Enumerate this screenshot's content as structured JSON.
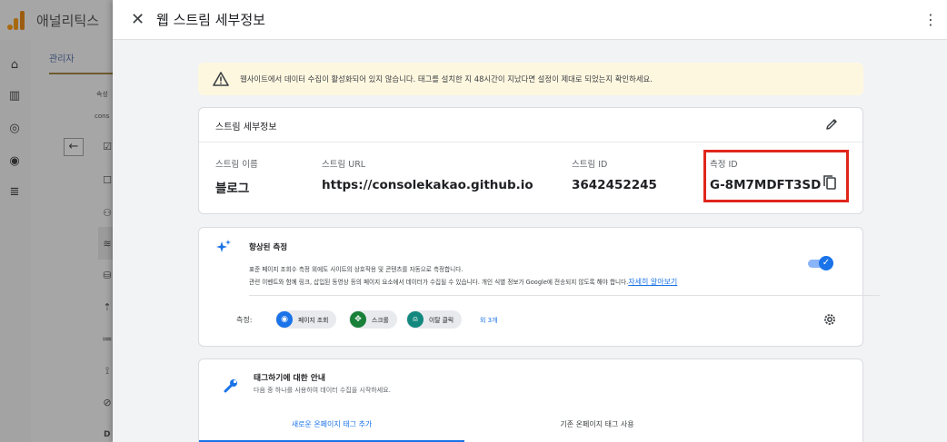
{
  "background": {
    "app_title": "애널리틱스",
    "admin_tab": "관리자",
    "small_label_1": "속성",
    "small_label_2": "cons",
    "bottom_letter": "D"
  },
  "drawer": {
    "title": "웹 스트림 세부정보",
    "warning": "웹사이트에서 데이터 수집이 활성화되어 있지 않습니다. 태그를 설치한 지 48시간이 지났다면 설정이 제대로 되었는지 확인하세요.",
    "stream_details": {
      "heading": "스트림 세부정보",
      "fields": {
        "name": {
          "label": "스트림 이름",
          "value": "블로그"
        },
        "url": {
          "label": "스트림 URL",
          "value": "https://consolekakao.github.io"
        },
        "stream_id": {
          "label": "스트림 ID",
          "value": "3642452245"
        },
        "measurement_id": {
          "label": "측정 ID",
          "value": "G-8M7MDFT3SD"
        }
      }
    },
    "enhanced_measurement": {
      "title": "향상된 측정",
      "desc_line1": "표준 페이지 조회수 측정 외에도 사이트의 상호작용 및 콘텐츠를 자동으로 측정합니다.",
      "desc_line2": "관련 이벤트와 함께 링크, 삽입된 동영상 등의 페이지 요소에서 데이터가 수집될 수 있습니다. 개인 식별 정보가 Google에 전송되지 않도록 해야 합니다.",
      "learn_more": "자세히 알아보기",
      "enabled": true,
      "metrics_label": "측정:",
      "chips": [
        {
          "label": "페이지 조회",
          "icon": "eye-icon",
          "color": "#1a73e8"
        },
        {
          "label": "스크롤",
          "icon": "scroll-icon",
          "color": "#188038"
        },
        {
          "label": "이탈 클릭",
          "icon": "mouse-icon",
          "color": "#12887e"
        }
      ],
      "more": "외 3개"
    },
    "tagging": {
      "title": "태그하기에 대한 안내",
      "subtitle": "다음 중 하나를 사용하여 데이터 수집을 시작하세요.",
      "tabs": [
        "새로운 온페이지 태그 추가",
        "기존 온페이지 태그 사용"
      ]
    }
  },
  "colors": {
    "accent": "#1a73e8",
    "warning_bg": "#fef7e0",
    "highlight": "#e0261c"
  }
}
